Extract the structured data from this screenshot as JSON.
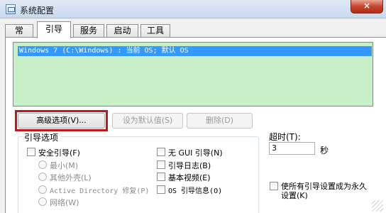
{
  "window": {
    "title": "系统配置",
    "close_symbol": "×"
  },
  "tabs": [
    {
      "label": "常规"
    },
    {
      "label": "引导"
    },
    {
      "label": "服务"
    },
    {
      "label": "启动"
    },
    {
      "label": "工具"
    }
  ],
  "active_tab": "引导",
  "boot_list": {
    "entries": [
      "Windows 7 (C:\\Windows) : 当前 OS; 默认 OS"
    ],
    "selected_index": 0
  },
  "buttons": {
    "advanced": "高级选项(V)...",
    "set_default": "设为默认值(S)",
    "delete": "删除(D)"
  },
  "boot_options": {
    "title": "引导选项",
    "safe_boot": "安全引导(F)",
    "minimal": "最小(M)",
    "alternate_shell": "其他外壳(L)",
    "active_directory_repair": "Active Directory 修复(P)",
    "network": "网络(W)",
    "no_gui_boot": "无 GUI 引导(N)",
    "boot_log": "引导日志(B)",
    "base_video": "基本视频(E)",
    "os_boot_info": "OS 引导信息(O)"
  },
  "timeout": {
    "label": "超时(T):",
    "value": "3",
    "unit": "秒"
  },
  "make_permanent": {
    "label_line1": "使所有引导设置成为永久",
    "label_line2": "设置(K)"
  },
  "colors": {
    "list_bg": "#c8f0c8",
    "selection": "#3399ff",
    "highlight_border": "#c0181b"
  }
}
